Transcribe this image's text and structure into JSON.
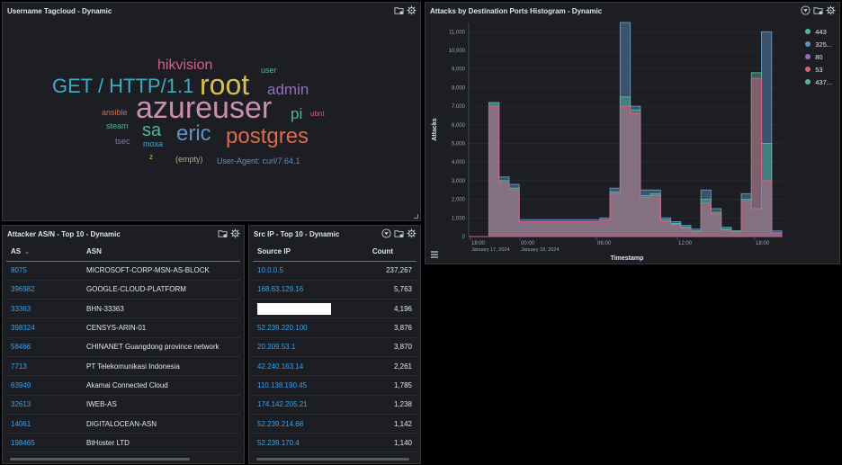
{
  "tagcloud": {
    "title": "Username Tagcloud - Dynamic",
    "tags": [
      {
        "text": "hikvision",
        "color": "#d36086"
      },
      {
        "text": "user",
        "color": "#54b399"
      },
      {
        "text": "GET / HTTP/1.1",
        "color": "#3eadc3"
      },
      {
        "text": "root",
        "color": "#d6bf57"
      },
      {
        "text": "admin",
        "color": "#9170b8"
      },
      {
        "text": "ansible",
        "color": "#da6c4b"
      },
      {
        "text": "azureuser",
        "color": "#ca8eae"
      },
      {
        "text": "pi",
        "color": "#54b399"
      },
      {
        "text": "ubnt",
        "color": "#d36086"
      },
      {
        "text": "steam",
        "color": "#54b399"
      },
      {
        "text": "sa",
        "color": "#54b399"
      },
      {
        "text": "eric",
        "color": "#6092c0"
      },
      {
        "text": "postgres",
        "color": "#da6c4b"
      },
      {
        "text": "tsec",
        "color": "#9170b8"
      },
      {
        "text": "moxa",
        "color": "#3eadc3"
      },
      {
        "text": "z",
        "color": "#d6bf57"
      },
      {
        "text": "(empty)",
        "color": "#b9a888"
      },
      {
        "text": "User-Agent: curl/7.64.1",
        "color": "#6092c0"
      }
    ]
  },
  "asn_table": {
    "title": "Attacker AS/N - Top 10 - Dynamic",
    "columns": [
      "AS",
      "ASN"
    ],
    "rows": [
      [
        "8075",
        "MICROSOFT-CORP-MSN-AS-BLOCK"
      ],
      [
        "396982",
        "GOOGLE-CLOUD-PLATFORM"
      ],
      [
        "33363",
        "BHN-33363"
      ],
      [
        "398324",
        "CENSYS-ARIN-01"
      ],
      [
        "58466",
        "CHINANET Guangdong province network"
      ],
      [
        "7713",
        "PT Telekomunikasi Indonesia"
      ],
      [
        "63949",
        "Akamai Connected Cloud"
      ],
      [
        "32613",
        "IWEB-AS"
      ],
      [
        "14061",
        "DIGITALOCEAN-ASN"
      ],
      [
        "198465",
        "BtHoster LTD"
      ]
    ]
  },
  "srcip_table": {
    "title": "Src IP - Top 10 - Dynamic",
    "columns": [
      "Source IP",
      "Count"
    ],
    "rows": [
      [
        "10.0.0.5",
        "237,267"
      ],
      [
        "168.63.129.16",
        "5,763"
      ],
      [
        "",
        "4,196"
      ],
      [
        "52.239.220.100",
        "3,876"
      ],
      [
        "20.209.53.1",
        "3,870"
      ],
      [
        "42.240.163.14",
        "2,261"
      ],
      [
        "110.138.190.45",
        "1,785"
      ],
      [
        "174.142.205.21",
        "1,238"
      ],
      [
        "52.239.214.68",
        "1,142"
      ],
      [
        "52.239.170.4",
        "1,140"
      ]
    ]
  },
  "histogram": {
    "title": "Attacks by Destination Ports Histogram - Dynamic",
    "legend": [
      {
        "label": "443",
        "color": "#54b399"
      },
      {
        "label": "325...",
        "color": "#6092c0"
      },
      {
        "label": "80",
        "color": "#9170b8"
      },
      {
        "label": "53",
        "color": "#d36086"
      },
      {
        "label": "437...",
        "color": "#54b399"
      }
    ]
  },
  "chart_data": {
    "type": "area",
    "title": "Attacks by Destination Ports Histogram - Dynamic",
    "xlabel": "Timestamp",
    "ylabel": "Attacks",
    "y_ticks": [
      "0",
      "1,000",
      "2,000",
      "3,000",
      "4,000",
      "5,000",
      "6,000",
      "7,000",
      "8,000",
      "9,000",
      "10,000",
      "11,000"
    ],
    "x_ticks": [
      "18:00",
      "00:00",
      "06:00",
      "12:00",
      "18:00"
    ],
    "x_sublabels": [
      "January 17, 2024",
      "January 18, 2024"
    ],
    "ylim": [
      0,
      11500
    ],
    "series": [
      {
        "name": "443",
        "color": "#6092c0",
        "values": [
          0,
          0,
          7200,
          3200,
          2800,
          900,
          900,
          900,
          900,
          900,
          900,
          900,
          900,
          1000,
          2600,
          11500,
          7000,
          2500,
          2500,
          1000,
          800,
          600,
          400,
          2500,
          1500,
          500,
          300,
          2300,
          1500,
          11000,
          300
        ]
      },
      {
        "name": "80",
        "color": "#54b399",
        "values": [
          0,
          0,
          7200,
          3000,
          2600,
          800,
          800,
          800,
          800,
          800,
          800,
          800,
          800,
          900,
          2400,
          7500,
          6800,
          2200,
          2300,
          900,
          700,
          500,
          300,
          2000,
          1300,
          400,
          300,
          2000,
          8800,
          5000,
          200
        ]
      },
      {
        "name": "53",
        "color": "#d36086",
        "values": [
          0,
          0,
          7000,
          2900,
          2500,
          800,
          800,
          800,
          800,
          800,
          800,
          800,
          800,
          900,
          2300,
          7000,
          6600,
          2100,
          2200,
          800,
          650,
          450,
          250,
          1800,
          1200,
          350,
          250,
          1900,
          8500,
          3000,
          200
        ]
      }
    ],
    "grid": true,
    "legend_position": "top-right"
  }
}
